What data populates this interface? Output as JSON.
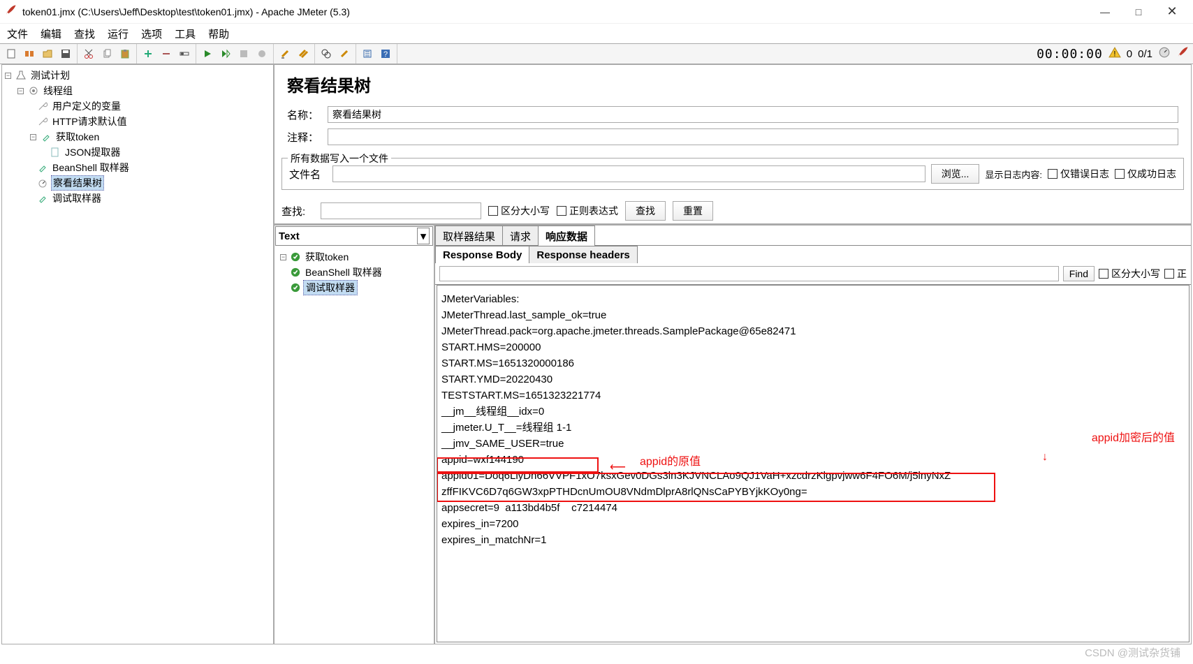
{
  "window": {
    "title": "token01.jmx (C:\\Users\\Jeff\\Desktop\\test\\token01.jmx) - Apache JMeter (5.3)",
    "min": "—",
    "max": "□",
    "close": "✕"
  },
  "menu": {
    "file": "文件",
    "edit": "编辑",
    "find": "查找",
    "run": "运行",
    "options": "选项",
    "tools": "工具",
    "help": "帮助"
  },
  "status": {
    "timer": "00:00:00",
    "warn_count": "0",
    "threads": "0/1"
  },
  "tree": {
    "plan": "测试计划",
    "thread_group": "线程组",
    "user_vars": "用户定义的变量",
    "http_defaults": "HTTP请求默认值",
    "get_token": "获取token",
    "json_extractor": "JSON提取器",
    "beanshell": "BeanShell 取样器",
    "view_results": "察看结果树",
    "debug_sampler": "调试取样器"
  },
  "panel": {
    "title": "察看结果树",
    "name_label": "名称：",
    "name_value": "察看结果树",
    "comment_label": "注释：",
    "comment_value": "",
    "file_legend": "所有数据写入一个文件",
    "filename_label": "文件名",
    "filename_value": "",
    "browse": "浏览...",
    "show_log": "显示日志内容:",
    "only_error": "仅错误日志",
    "only_success": "仅成功日志",
    "search_label": "查找:",
    "case": "区分大小写",
    "regex": "正则表达式",
    "search_btn": "查找",
    "reset_btn": "重置"
  },
  "results_list": {
    "renderer": "Text",
    "items": [
      {
        "label": "获取token"
      },
      {
        "label": "BeanShell 取样器"
      },
      {
        "label": "调试取样器"
      }
    ],
    "selected_index": 2
  },
  "detail": {
    "tab_sampler": "取样器结果",
    "tab_request": "请求",
    "tab_response": "响应数据",
    "tab_body": "Response Body",
    "tab_headers": "Response headers",
    "find": "Find",
    "case": "区分大小写",
    "regex": "正"
  },
  "response": {
    "l1": "JMeterVariables:",
    "l2": "JMeterThread.last_sample_ok=true",
    "l3": "JMeterThread.pack=org.apache.jmeter.threads.SamplePackage@65e82471",
    "l4": "START.HMS=200000",
    "l5": "START.MS=1651320000186",
    "l6": "START.YMD=20220430",
    "l7": "TESTSTART.MS=1651323221774",
    "l8": "__jm__线程组__idx=0",
    "l9": "__jmeter.U_T__=线程组 1-1",
    "l10": "__jmv_SAME_USER=true",
    "l11": "appid=wxf144190",
    "l12": "appid01=Doq6LiyDh66VVPF1xO7ksxGev0DGs3ln3KJVNCLAo9QJ1VaH+xzcdrzKlgpvjww6F4FO6M/j5lnyNxZ",
    "l13": "zffFIKVC6D7q6GW3xpPTHDcnUmOU8VNdmDlprA8rlQNsCaPYBYjkKOy0ng=",
    "l14": "appsecret=9  a113bd4b5f    c7214474",
    "l15": "expires_in=7200",
    "l16": "expires_in_matchNr=1"
  },
  "annotation": {
    "label_orig": "appid的原值",
    "label_enc": "appid加密后的值"
  },
  "watermark": "CSDN @测试杂货铺"
}
